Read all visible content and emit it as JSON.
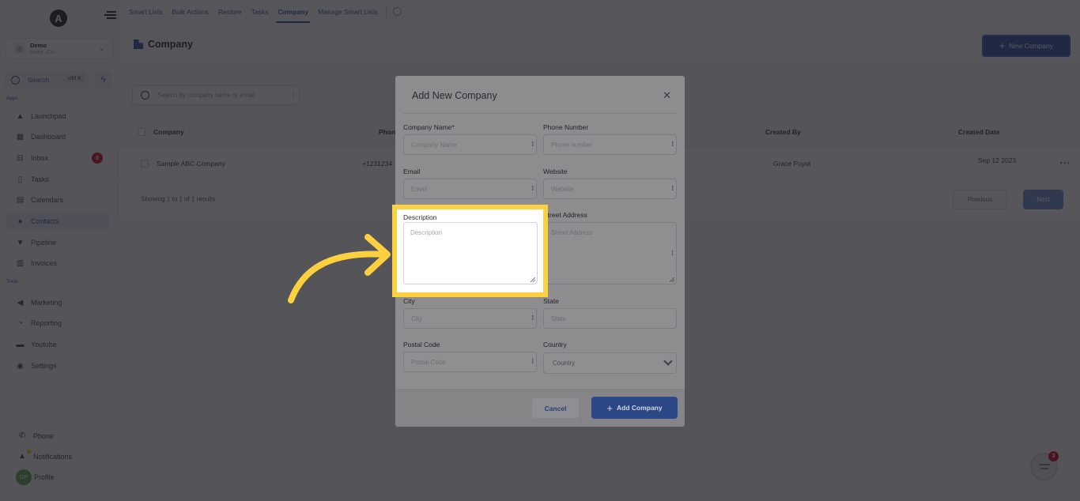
{
  "sidebar": {
    "logo_letter": "A",
    "location": {
      "name": "Demo",
      "sub": "Irvine, CA"
    },
    "search": {
      "label": "Search",
      "shortcut": "ctrl K"
    },
    "sections": {
      "apps": "Apps",
      "tools": "Tools"
    },
    "items": [
      {
        "label": "Launchpad",
        "icon": "rocket-icon"
      },
      {
        "label": "Dashboard",
        "icon": "dashboard-icon"
      },
      {
        "label": "Inbox",
        "icon": "inbox-icon",
        "badge": "0"
      },
      {
        "label": "Tasks",
        "icon": "clipboard-icon"
      },
      {
        "label": "Calendars",
        "icon": "calendar-icon"
      },
      {
        "label": "Contacts",
        "icon": "user-icon",
        "active": true
      },
      {
        "label": "Pipeline",
        "icon": "funnel-icon"
      },
      {
        "label": "Invoices",
        "icon": "invoice-icon"
      }
    ],
    "tools": [
      {
        "label": "Marketing",
        "icon": "megaphone-icon"
      },
      {
        "label": "Reporting",
        "icon": "pie-chart-icon"
      },
      {
        "label": "Youtube",
        "icon": "youtube-icon"
      },
      {
        "label": "Settings",
        "icon": "gear-icon"
      }
    ],
    "bottom": {
      "phone": "Phone",
      "notifications": "Notifications",
      "profile": "Profile",
      "profile_initials": "GP"
    }
  },
  "topnav": {
    "tabs": [
      {
        "label": "Smart Lists"
      },
      {
        "label": "Bulk Actions"
      },
      {
        "label": "Restore"
      },
      {
        "label": "Tasks"
      },
      {
        "label": "Company",
        "active": true
      },
      {
        "label": "Manage Smart Lists"
      }
    ]
  },
  "page": {
    "title": "Company",
    "new_button": "New Company"
  },
  "list": {
    "search_placeholder": "Search by company name or email",
    "columns": {
      "company": "Company",
      "phone": "Phone",
      "created_by": "Created By",
      "created_date": "Created Date"
    },
    "rows": [
      {
        "company": "Sample ABC Company",
        "phone": "+1231234",
        "created_by": "Grace Puyot",
        "created_date": "Sep 12 2023"
      }
    ],
    "showing": "Showing 1 to 1 of 1 results",
    "previous": "Previous",
    "next": "Next"
  },
  "chat": {
    "badge": "3"
  },
  "modal": {
    "title": "Add New Company",
    "fields": {
      "company_name": {
        "label": "Company Name*",
        "placeholder": "Company Name"
      },
      "phone": {
        "label": "Phone Number",
        "placeholder": "Phone number"
      },
      "email": {
        "label": "Email",
        "placeholder": "Email"
      },
      "website": {
        "label": "Website",
        "placeholder": "Website"
      },
      "description": {
        "label": "Description",
        "placeholder": "Description"
      },
      "street": {
        "label": "Street Address",
        "placeholder": "Street Address"
      },
      "city": {
        "label": "City",
        "placeholder": "City"
      },
      "state": {
        "label": "State",
        "placeholder": "State"
      },
      "postal": {
        "label": "Postal Code",
        "placeholder": "Postal Code"
      },
      "country": {
        "label": "Country",
        "value": "Country"
      }
    },
    "cancel": "Cancel",
    "submit": "Add Company"
  },
  "callout": {
    "color": "#fdd03f",
    "target": "description"
  }
}
